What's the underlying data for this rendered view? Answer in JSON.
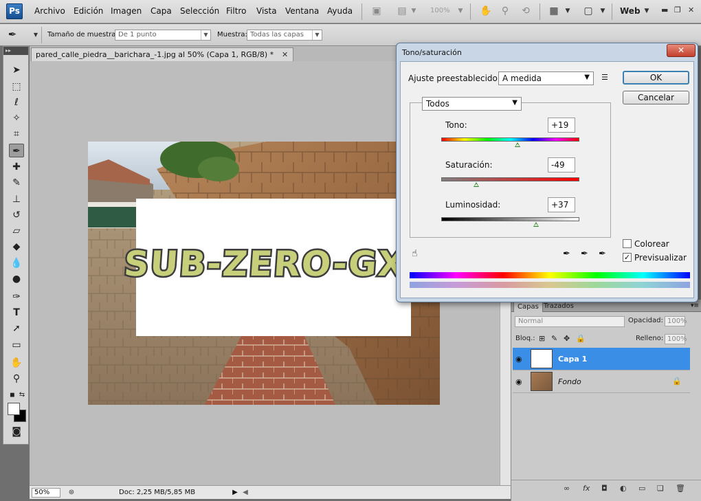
{
  "app": {
    "logo": "Ps",
    "menu": [
      "Archivo",
      "Edición",
      "Imagen",
      "Capa",
      "Selección",
      "Filtro",
      "Vista",
      "Ventana",
      "Ayuda"
    ],
    "zoom_menu": "100%",
    "workspace": "Web"
  },
  "options": {
    "sample_size_label": "Tamaño de muestra:",
    "sample_size_value": "De 1 punto",
    "sample_label": "Muestra:",
    "sample_value": "Todas las capas"
  },
  "document": {
    "tab_title": "pared_calle_piedra__barichara_-1.jpg al 50% (Capa 1, RGB/8) *",
    "graffiti_text": "SUB-ZERO-GX",
    "zoom": "50%",
    "doc_info": "Doc: 2,25 MB/5,85 MB"
  },
  "dialog": {
    "title": "Tono/saturación",
    "preset_label": "Ajuste preestablecido:",
    "preset_value": "A medida",
    "ok": "OK",
    "cancel": "Cancelar",
    "channel": "Todos",
    "hue_label": "Tono:",
    "hue_value": "+19",
    "hue_level": 19,
    "saturation_label": "Saturación:",
    "saturation_value": "-49",
    "saturation_level": -49,
    "lightness_label": "Luminosidad:",
    "lightness_value": "+37",
    "lightness_level": 37,
    "colorize_label": "Colorear",
    "colorize_checked": false,
    "preview_label": "Previsualizar",
    "preview_checked": true
  },
  "layers": {
    "tabs": [
      "Capas",
      "Trazados"
    ],
    "blend_mode": "Normal",
    "opacity_label": "Opacidad:",
    "opacity_value": "100%",
    "lock_label": "Bloq.:",
    "fill_label": "Relleno:",
    "fill_value": "100%",
    "items": [
      {
        "name": "Capa 1",
        "selected": true
      },
      {
        "name": "Fondo",
        "selected": false
      }
    ]
  },
  "colors": {
    "selection": "#3b8ee6",
    "graffiti_fill": "#c8cf7a",
    "graffiti_outline": "#3d3d3d"
  }
}
